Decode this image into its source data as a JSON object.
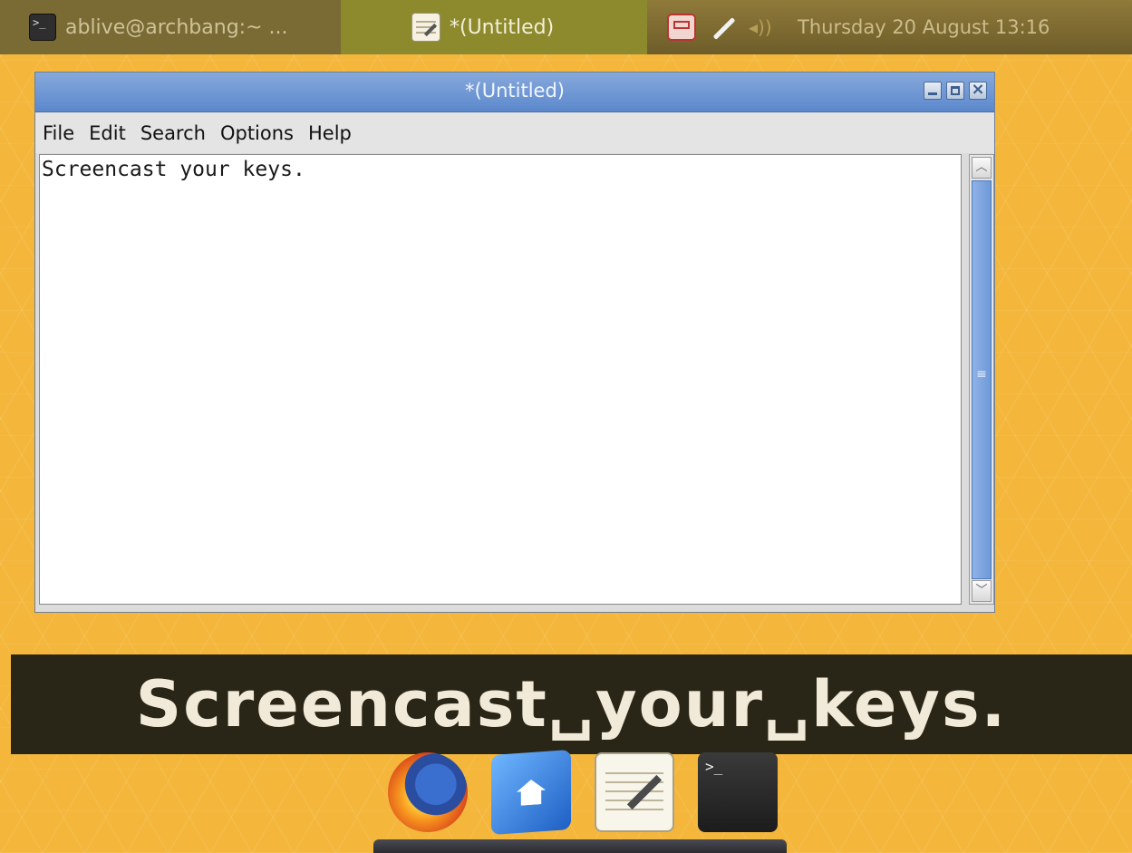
{
  "top_panel": {
    "tasks": [
      {
        "label": "ablive@archbang:~ ...",
        "icon": "terminal-icon"
      },
      {
        "label": "*(Untitled)",
        "icon": "text-editor-icon"
      }
    ],
    "tray": {
      "network_icon": "network-icon",
      "plug_icon": "power-plug-icon",
      "volume_icon": "volume-icon",
      "volume_glyph": "◂))"
    },
    "clock": "Thursday 20 August 13:16"
  },
  "editor": {
    "title": "*(Untitled)",
    "menu": [
      "File",
      "Edit",
      "Search",
      "Options",
      "Help"
    ],
    "content": "Screencast your keys."
  },
  "screenkey": {
    "text": "Screencast␣your␣keys."
  },
  "dock": {
    "items": [
      {
        "name": "firefox",
        "icon": "firefox-icon"
      },
      {
        "name": "file-manager",
        "icon": "home-folder-icon"
      },
      {
        "name": "text-editor",
        "icon": "text-editor-icon"
      },
      {
        "name": "terminal",
        "icon": "terminal-icon",
        "glyph": ">_"
      }
    ]
  },
  "colors": {
    "desktop": "#f4b73c",
    "titlebar": "#6e95d3",
    "screenkey_bar": "#2a2617",
    "screenkey_text": "#f1ead8"
  }
}
